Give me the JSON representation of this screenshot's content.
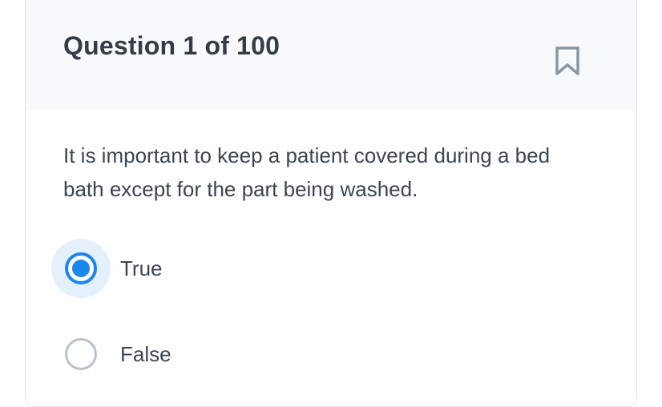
{
  "question": {
    "header": "Question 1 of 100",
    "text": "It is important to keep a patient covered during a bed bath except for the part being washed.",
    "bookmark_icon": "bookmark-icon"
  },
  "options": [
    {
      "label": "True",
      "selected": true
    },
    {
      "label": "False",
      "selected": false
    }
  ],
  "colors": {
    "accent": "#1a85ea",
    "selected_bg": "#e4f0fc",
    "header_bg": "#f7f9fb",
    "text": "#3c4550",
    "radio_border": "#b9c2cb"
  }
}
